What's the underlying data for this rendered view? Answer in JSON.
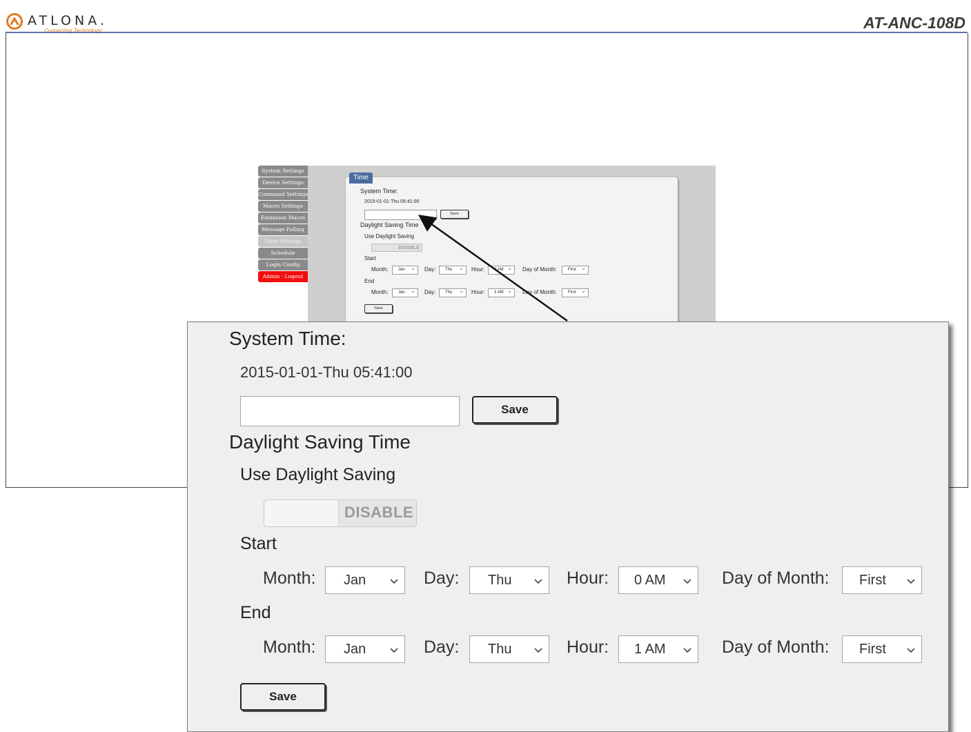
{
  "header": {
    "brand_name": "ATLONA.",
    "brand_tagline": "Connecting Technology",
    "model": "AT-ANC-108D"
  },
  "colors": {
    "accent_blue": "#4a6d9f",
    "header_line": "#5b6fa8",
    "nav_gray": "#8a8a8a",
    "logout_red": "#f20d0d",
    "logo_orange": "#e07b20"
  },
  "icons": {
    "logo": "atlona-logo-icon",
    "select_arrow": "chevron-down-icon"
  },
  "sidebar": {
    "items": [
      {
        "label": "System Settings"
      },
      {
        "label": "Device Settings"
      },
      {
        "label": "Command Settings"
      },
      {
        "label": "Macro Settings"
      },
      {
        "label": "Extension Macro"
      },
      {
        "label": "Message Polling"
      },
      {
        "label": "Time Settings"
      },
      {
        "label": "Schedule"
      },
      {
        "label": "Login Config"
      },
      {
        "label": "Admin - Logout"
      }
    ]
  },
  "panel": {
    "tab": "Time",
    "system_time_label": "System Time:",
    "system_time_value": "2015-01-01-Thu 05:41:00",
    "time_input_value": "",
    "save_label": "Save",
    "dst_heading": "Daylight Saving Time",
    "use_dst_label": "Use Daylight Saving",
    "dst_toggle_state": "DISABLE",
    "start_label": "Start",
    "end_label": "End",
    "month_label": "Month:",
    "day_label": "Day:",
    "hour_label": "Hour:",
    "day_of_month_label": "Day of Month:",
    "start": {
      "month": "Jan",
      "day": "Thu",
      "hour": "0 AM",
      "day_of_month": "First"
    },
    "end": {
      "month": "Jan",
      "day": "Thu",
      "hour": "1 AM",
      "day_of_month": "First"
    },
    "bottom_save_label": "Save"
  }
}
